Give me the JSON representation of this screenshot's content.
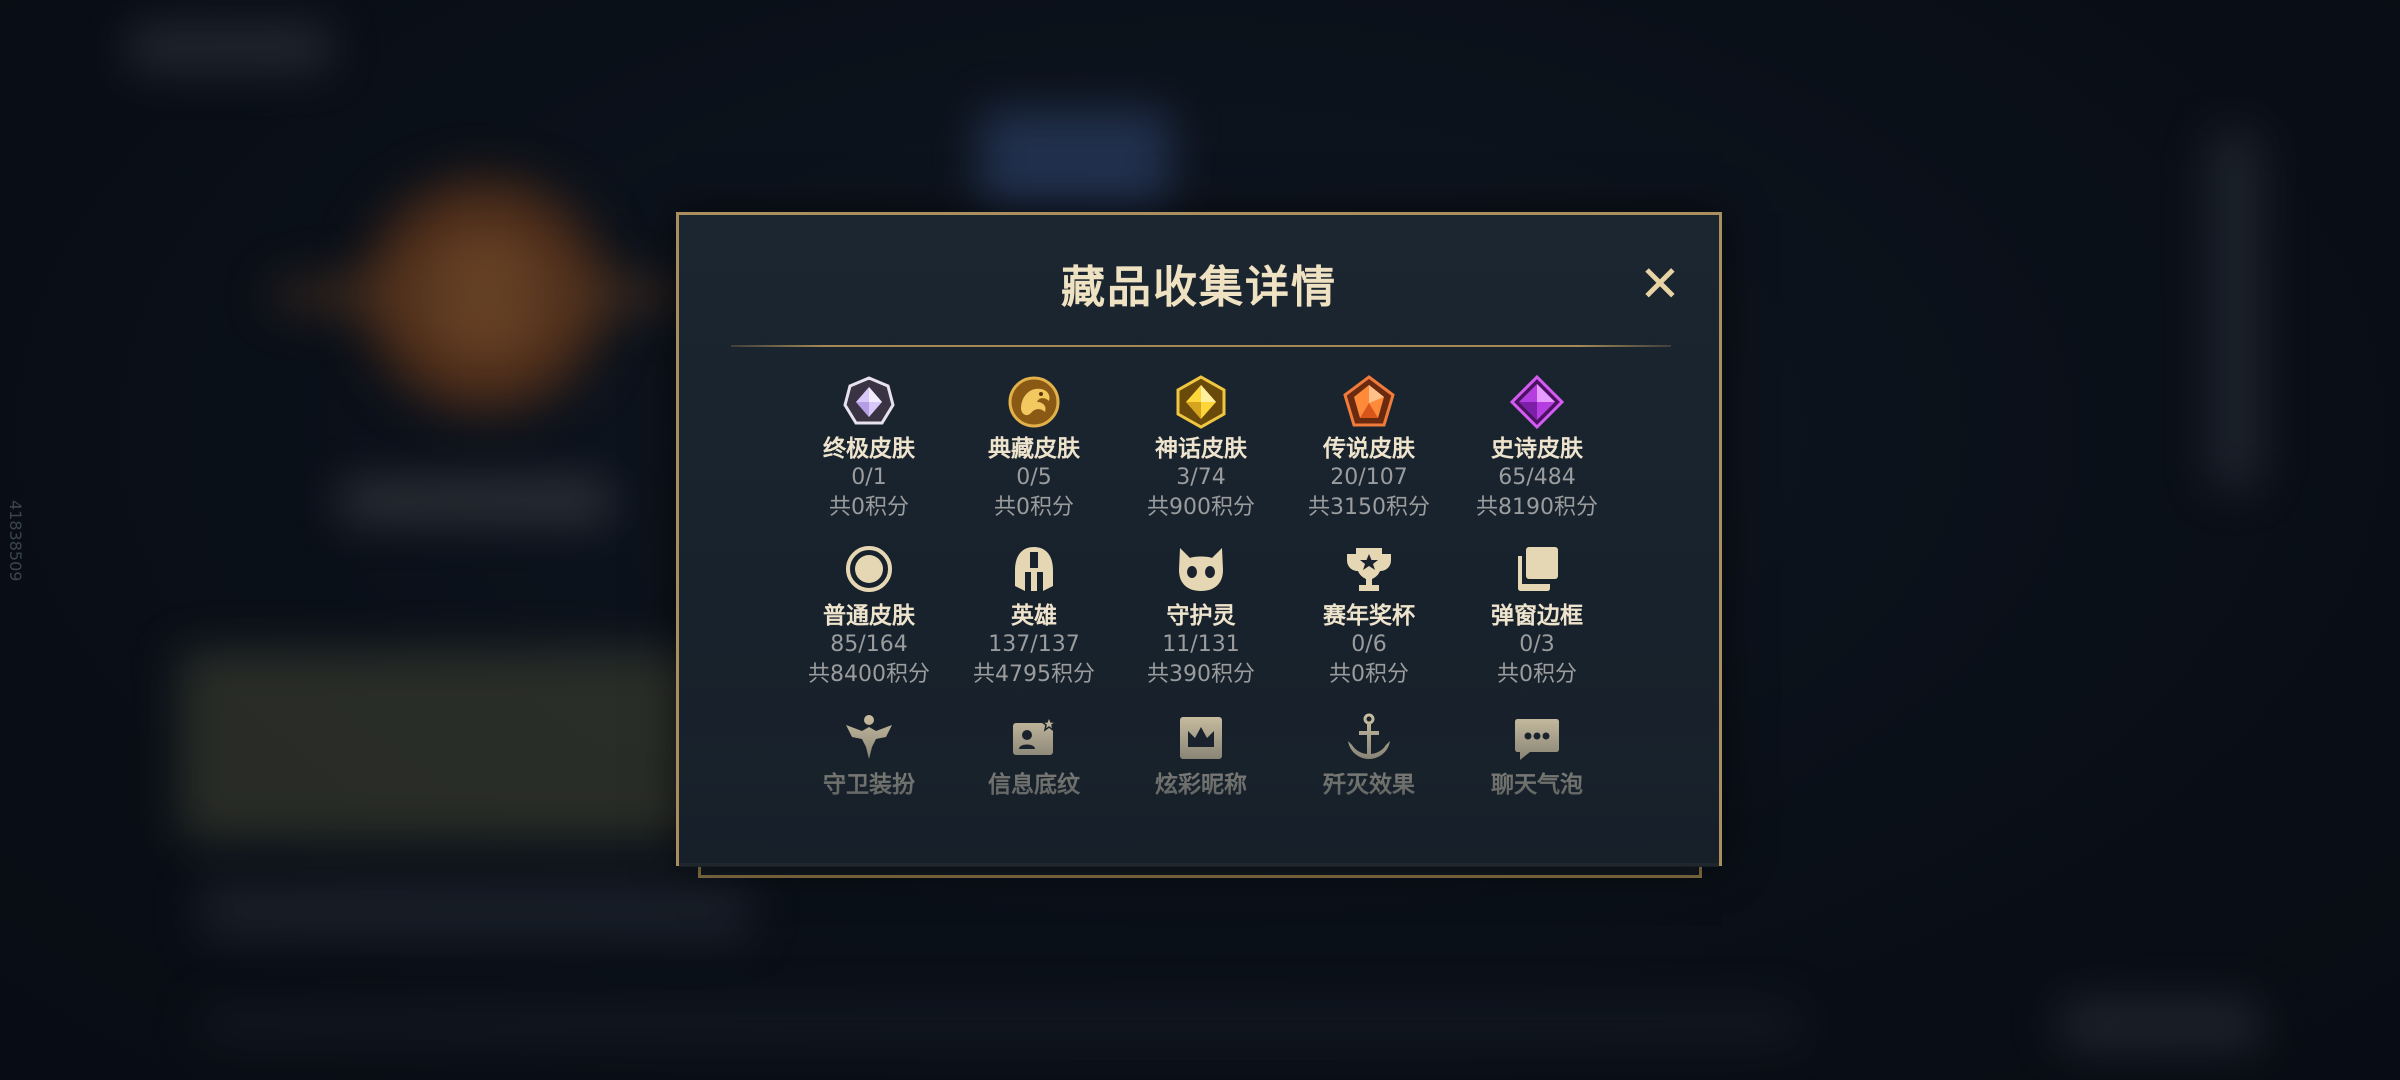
{
  "modal": {
    "title": "藏品收集详情",
    "close_symbol": "✕"
  },
  "side_id": "41838509",
  "colors": {
    "accent_gold": "#a98f5e",
    "title_text": "#efe2c2",
    "muted_text": "#9a9c9e"
  },
  "items": [
    {
      "label": "终极皮肤",
      "count": "0/1",
      "points": "共0积分",
      "icon": "ultimate-gem-icon"
    },
    {
      "label": "典藏皮肤",
      "count": "0/5",
      "points": "共0积分",
      "icon": "collector-dragon-icon"
    },
    {
      "label": "神话皮肤",
      "count": "3/74",
      "points": "共900积分",
      "icon": "mythic-gem-icon"
    },
    {
      "label": "传说皮肤",
      "count": "20/107",
      "points": "共3150积分",
      "icon": "legendary-gem-icon"
    },
    {
      "label": "史诗皮肤",
      "count": "65/484",
      "points": "共8190积分",
      "icon": "epic-gem-icon"
    },
    {
      "label": "普通皮肤",
      "count": "85/164",
      "points": "共8400积分",
      "icon": "circle-icon"
    },
    {
      "label": "英雄",
      "count": "137/137",
      "points": "共4795积分",
      "icon": "helmet-icon"
    },
    {
      "label": "守护灵",
      "count": "11/131",
      "points": "共390积分",
      "icon": "spirit-icon"
    },
    {
      "label": "赛年奖杯",
      "count": "0/6",
      "points": "共0积分",
      "icon": "trophy-icon"
    },
    {
      "label": "弹窗边框",
      "count": "0/3",
      "points": "共0积分",
      "icon": "frames-icon"
    },
    {
      "label": "守卫装扮",
      "icon": "ward-icon"
    },
    {
      "label": "信息底纹",
      "icon": "profile-card-icon"
    },
    {
      "label": "炫彩昵称",
      "icon": "crown-card-icon"
    },
    {
      "label": "歼灭效果",
      "icon": "anchor-icon"
    },
    {
      "label": "聊天气泡",
      "icon": "chat-bubble-icon"
    }
  ]
}
